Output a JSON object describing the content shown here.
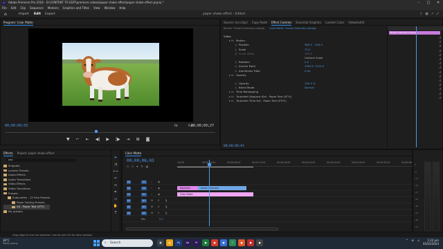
{
  "titlebar": {
    "text": "Adobe Premiere Pro 2024 - D:\\CONTENT TO EDIT\\premiere videos\\paper shake effect\\paper shake effect.prproj *",
    "icon": "Pr"
  },
  "menu": [
    "File",
    "Edit",
    "Clip",
    "Sequence",
    "Markers",
    "Graphics and Titles",
    "View",
    "Window",
    "Help"
  ],
  "workspace": {
    "tabs": [
      "Import",
      "Edit",
      "Export"
    ],
    "active": "Edit",
    "project": "paper shake effect",
    "project_suffix": "- Edited"
  },
  "program": {
    "title": "Program: Color Matte",
    "timecode_left": "00;00;06;03",
    "fit": "Fit",
    "quality": "Full",
    "timecode_right": "00;00;09;27"
  },
  "effect_controls": {
    "tabs": [
      "Source: (no clips)",
      "Copy Paste",
      "Effect Controls",
      "Essential Graphics",
      "Lumetri Color",
      "VideoAuth3"
    ],
    "source": "Source * brown Guernsey cow.jpg",
    "clip": "Color Matte * brown Guernsey cow.jpg",
    "clip_bar": "Brown Guernsey cow.jpg",
    "rows": [
      {
        "label": "Video",
        "indent": 0
      },
      {
        "label": "Motion",
        "indent": 1,
        "fx": "fx"
      },
      {
        "label": "Position",
        "indent": 2,
        "v1": "960.0",
        "v2": "540.0"
      },
      {
        "label": "Scale",
        "indent": 2,
        "v1": "70.0"
      },
      {
        "label": "Scale Width",
        "indent": 2,
        "v1": "100.0",
        "dim": true
      },
      {
        "label": "",
        "indent": 2,
        "v1": "Uniform Scale",
        "check": true
      },
      {
        "label": "Rotation",
        "indent": 2,
        "v1": "0.0"
      },
      {
        "label": "Anchor Point",
        "indent": 2,
        "v1": "2000.0",
        "v2": "1315.0"
      },
      {
        "label": "Anti-flicker Filter",
        "indent": 2,
        "v1": "0.00"
      },
      {
        "label": "Opacity",
        "indent": 1,
        "fx": "fx"
      },
      {
        "label": "",
        "indent": 2,
        "v1": ""
      },
      {
        "label": "Opacity",
        "indent": 2,
        "v1": "100.0 %"
      },
      {
        "label": "Blend Mode",
        "indent": 2,
        "v1": "Normal"
      },
      {
        "label": "Time Remapping",
        "indent": 1,
        "fx": "fx"
      },
      {
        "label": "Turbulent Displace (Ext - Paper Text (XTY))",
        "indent": 1,
        "fx": "fx"
      },
      {
        "label": "Turbulent Time Ext - Paper Text (XTY2)",
        "indent": 1,
        "fx": "fx"
      }
    ],
    "timecode": "00;00;06;03"
  },
  "project": {
    "tabs": [
      "Effects",
      "Project: paper shake effect"
    ],
    "search": "pap",
    "items": [
      {
        "label": "Snippets",
        "indent": 0
      },
      {
        "label": "Lumetri Presets",
        "indent": 0
      },
      {
        "label": "Audio Effects",
        "indent": 0
      },
      {
        "label": "Audio Transitions",
        "indent": 0
      },
      {
        "label": "Video Effects",
        "indent": 0
      },
      {
        "label": "Video Transitions",
        "indent": 0
      },
      {
        "label": "Presets",
        "indent": 0
      },
      {
        "label": "Subsumfex - 12 Free Presets",
        "indent": 1
      },
      {
        "label": "Paper Folding Presets",
        "indent": 2
      },
      {
        "label": "XX - Paper Text (XTY)",
        "indent": 2,
        "selected": true
      },
      {
        "label": "My presets",
        "indent": 0
      }
    ]
  },
  "timeline": {
    "tab": "Color Matte",
    "timecode": "00;00;06;03",
    "ruler": [
      ":00;00",
      "00;00;04;00",
      "00;00;08;00",
      "00;00;12;00",
      "00;00;16;00",
      "00;00;20;00",
      "00;00;24;00",
      "00;00;28;00",
      "00;00;32;00",
      "00;00;36;00"
    ],
    "tracks": [
      {
        "label": "V3",
        "kind": "video"
      },
      {
        "label": "V2",
        "kind": "video"
      },
      {
        "label": "V1",
        "kind": "video"
      },
      {
        "label": "A1",
        "kind": "audio"
      },
      {
        "label": "A2",
        "kind": "audio"
      },
      {
        "label": "A3",
        "kind": "audio"
      },
      {
        "label": "Mix",
        "kind": "mix",
        "value": "0.0"
      }
    ],
    "clips": [
      {
        "label": "Adjustme",
        "track": 1,
        "color": "#dd88e8"
      },
      {
        "label": "brown Guernsey",
        "track": 1,
        "color": "#6fa7e6"
      },
      {
        "label": "Color Matte",
        "track": 2,
        "color": "#f0a6f3"
      }
    ]
  },
  "meters": {
    "scale": [
      "0",
      "-6",
      "-12",
      "-18",
      "-24",
      "-30",
      "-36",
      "-42",
      "-48",
      "-54"
    ]
  },
  "status": "Drag edge to trim the selection. Use Alt and Ctrl for other options.",
  "taskbar": {
    "temp": "30°C",
    "weather": "Partly sunny",
    "search": "Search",
    "time": "1:22 pm",
    "date": "05/03/2024"
  },
  "colors": {
    "accent": "#4f9bea",
    "clip_pink": "#f0a6f3",
    "clip_blue": "#6fa7e6",
    "clip_purple": "#dd88e8"
  }
}
